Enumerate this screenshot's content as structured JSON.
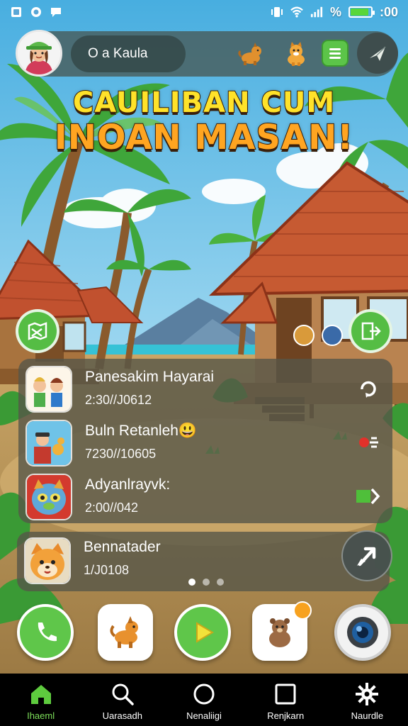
{
  "status_bar": {
    "battery_percent_label": "⁩%",
    "time": ":00",
    "battery_level": 0.9,
    "icons": [
      "notification-icon",
      "whatsapp-icon",
      "chat-icon",
      "vibrate-icon",
      "wifi-icon",
      "signal-icon",
      "battery-icon"
    ]
  },
  "profile": {
    "name": "O a Kaula"
  },
  "banner": {
    "line1": "CAUILIBAN CUM",
    "line2": "INOAN MASAN!"
  },
  "list_items": [
    {
      "title": "Panesakim Hayarai",
      "time": "2:30//J0612",
      "action_icon": "refresh-icon"
    },
    {
      "title": "Buln Retanleh😃",
      "time": "7230//10605",
      "action_icon": "toggle-icon"
    },
    {
      "title": "Adyanlrayvk:",
      "time": "2:00//042",
      "action_icon": "forward-arrow-icon"
    }
  ],
  "card": {
    "title": "Bennatader",
    "time": "1/J0108"
  },
  "pagination": {
    "active": 0,
    "count": 3
  },
  "dock": [
    "phone-button",
    "dog-app-button",
    "play-button",
    "bear-app-button",
    "camera-button"
  ],
  "dock_badge": " ",
  "nav": [
    {
      "label": "Ihaeml",
      "icon": "home-icon"
    },
    {
      "label": "Uarasadh",
      "icon": "search-icon"
    },
    {
      "label": "Nenaliigi",
      "icon": "circle-icon"
    },
    {
      "label": "Renjkarn",
      "icon": "square-icon"
    },
    {
      "label": "Naurdle",
      "icon": "gear-icon"
    }
  ],
  "colors": {
    "accent_green": "#55bd44",
    "nav_active": "#7ddf5a",
    "banner_yellow": "#ffe22a",
    "banner_orange": "#ffa521"
  }
}
